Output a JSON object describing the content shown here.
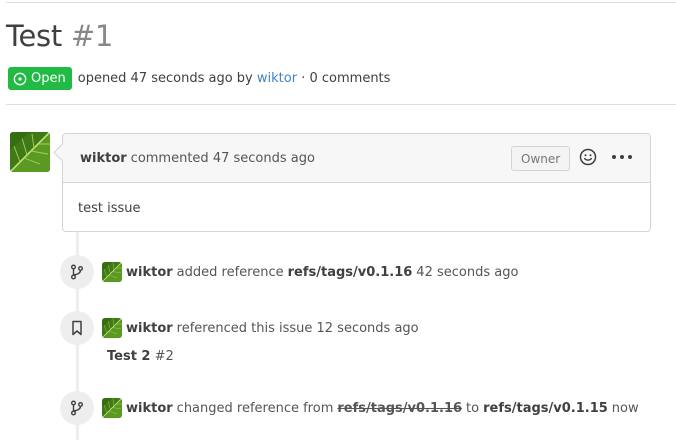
{
  "issue": {
    "title": "Test",
    "number": "#1",
    "status": "Open",
    "opened_text": "opened 47 seconds ago by",
    "author": "wiktor",
    "comments_text": "· 0 comments"
  },
  "comment": {
    "author": "wiktor",
    "action": "commented 47 seconds ago",
    "role_label": "Owner",
    "body": "test issue"
  },
  "timeline": [
    {
      "icon": "git-branch-icon",
      "user": "wiktor",
      "action": "added reference",
      "ref": "refs/tags/v0.1.16",
      "when": "42 seconds ago"
    },
    {
      "icon": "bookmark-icon",
      "user": "wiktor",
      "action": "referenced this issue 12 seconds ago",
      "linked_title": "Test 2",
      "linked_number": "#2"
    },
    {
      "icon": "git-branch-icon",
      "user": "wiktor",
      "action": "changed reference from",
      "old_ref": "refs/tags/v0.1.16",
      "to_word": "to",
      "new_ref": "refs/tags/v0.1.15",
      "when": "now"
    }
  ],
  "colors": {
    "open_badge": "#21ba45",
    "link": "#4183c4",
    "border": "#d4d4d5",
    "timeline": "#eeeeee"
  }
}
